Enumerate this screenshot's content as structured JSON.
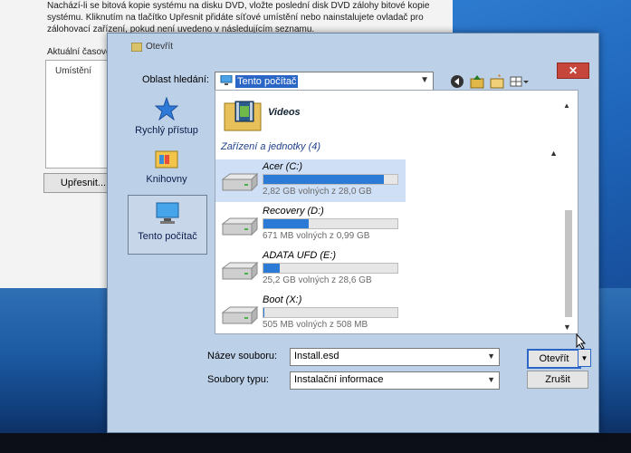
{
  "background_window": {
    "intro_text": "Nachází-li se bitová kopie systému na disku DVD, vložte poslední disk DVD zálohy bitové kopie systému. Kliknutím na tlačítko Upřesnit přidáte síťové umístění nebo nainstalujete ovladač pro zálohovací zařízení, pokud není uvedeno v následujícím seznamu.",
    "group_label": "Aktuální časové",
    "list_column": "Umístění",
    "advanced_button": "Upřesnit..."
  },
  "dialog": {
    "title": "Otevřít",
    "close_label": "✕",
    "look_in_label": "Oblast hledání:",
    "look_in_value": "Tento počítač",
    "places": [
      {
        "label": "Rychlý přístup",
        "icon": "star-icon"
      },
      {
        "label": "Knihovny",
        "icon": "library-folder-icon"
      },
      {
        "label": "Tento počítač",
        "icon": "computer-icon",
        "selected": true
      }
    ],
    "folder": {
      "name": "Videos",
      "icon": "video-folder-icon"
    },
    "group_header": "Zařízení a jednotky (4)",
    "drives": [
      {
        "name": "Acer (C:)",
        "free_text": "2,82 GB volných z 28,0 GB",
        "used_fraction": 0.9,
        "selected": true
      },
      {
        "name": "Recovery (D:)",
        "free_text": "671 MB volných z 0,99 GB",
        "used_fraction": 0.34
      },
      {
        "name": "ADATA UFD (E:)",
        "free_text": "25,2 GB volných z 28,6 GB",
        "used_fraction": 0.12
      },
      {
        "name": "Boot (X:)",
        "free_text": "505 MB volných z 508 MB",
        "used_fraction": 0.01
      }
    ],
    "file_name_label": "Název souboru:",
    "file_name_value": "Install.esd",
    "file_type_label": "Soubory typu:",
    "file_type_value": "Instalační informace",
    "open_button": "Otevřít",
    "cancel_button": "Zrušit"
  },
  "colors": {
    "selection": "#2b66c6",
    "bar_fill": "#2a7ad6",
    "dialog_frame": "#bcd0e8",
    "close_red": "#c7463c"
  }
}
